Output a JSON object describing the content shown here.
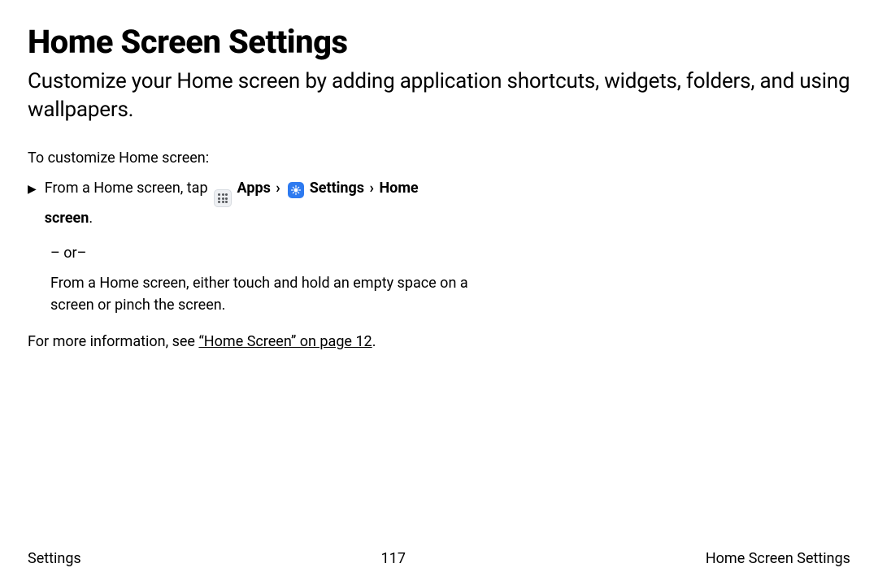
{
  "title": "Home Screen Settings",
  "subtitle": "Customize your Home screen by adding application shortcuts, widgets, folders, and using wallpapers.",
  "intro": "To customize Home screen:",
  "step": {
    "marker": "▶",
    "prefix": "From a Home screen, tap",
    "apps_label": "Apps",
    "settings_label": "Settings",
    "home_label": "Home screen",
    "chev": "›",
    "period": "."
  },
  "or_label": "– or–",
  "alt_text": "From a Home screen, either touch and hold an empty space on a screen or pinch the screen.",
  "more_info_prefix": "For more information, see ",
  "more_info_link": "“Home Screen” on page 12",
  "more_info_suffix": ".",
  "footer": {
    "left": "Settings",
    "center": "117",
    "right": "Home Screen Settings"
  }
}
